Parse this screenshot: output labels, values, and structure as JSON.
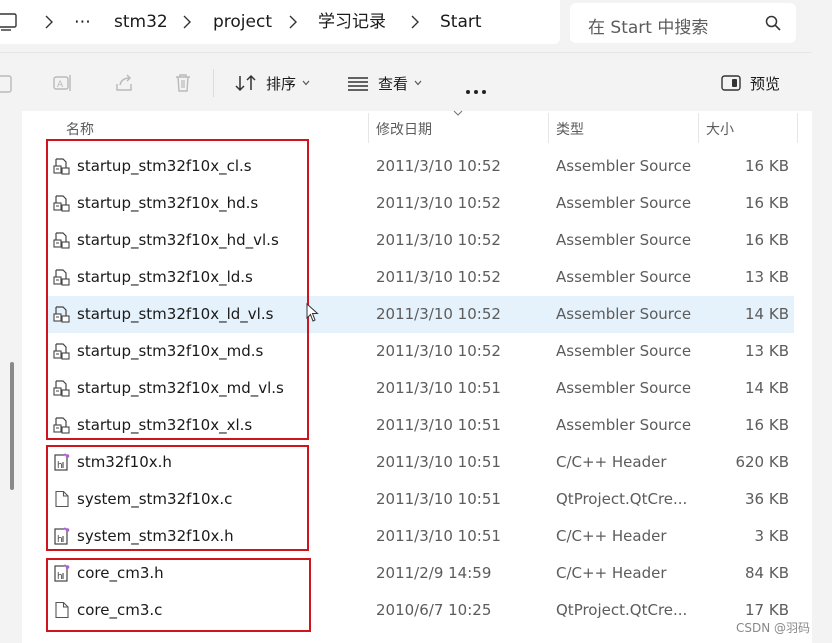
{
  "address": {
    "crumbs": [
      "⋯",
      "stm32",
      "project",
      "学习记录",
      "Start"
    ]
  },
  "search": {
    "placeholder": "在 Start 中搜索"
  },
  "toolbar": {
    "sort_label": "排序",
    "view_label": "查看",
    "preview_label": "预览"
  },
  "columns": {
    "name": "名称",
    "modified": "修改日期",
    "type": "类型",
    "size": "大小"
  },
  "files": [
    {
      "name": "startup_stm32f10x_cl.s",
      "modified": "2011/3/10 10:52",
      "type": "Assembler Source",
      "size": "16 KB",
      "icon": "assembler-file-icon"
    },
    {
      "name": "startup_stm32f10x_hd.s",
      "modified": "2011/3/10 10:52",
      "type": "Assembler Source",
      "size": "16 KB",
      "icon": "assembler-file-icon"
    },
    {
      "name": "startup_stm32f10x_hd_vl.s",
      "modified": "2011/3/10 10:52",
      "type": "Assembler Source",
      "size": "16 KB",
      "icon": "assembler-file-icon"
    },
    {
      "name": "startup_stm32f10x_ld.s",
      "modified": "2011/3/10 10:52",
      "type": "Assembler Source",
      "size": "13 KB",
      "icon": "assembler-file-icon"
    },
    {
      "name": "startup_stm32f10x_ld_vl.s",
      "modified": "2011/3/10 10:52",
      "type": "Assembler Source",
      "size": "14 KB",
      "icon": "assembler-file-icon"
    },
    {
      "name": "startup_stm32f10x_md.s",
      "modified": "2011/3/10 10:52",
      "type": "Assembler Source",
      "size": "13 KB",
      "icon": "assembler-file-icon"
    },
    {
      "name": "startup_stm32f10x_md_vl.s",
      "modified": "2011/3/10 10:51",
      "type": "Assembler Source",
      "size": "14 KB",
      "icon": "assembler-file-icon"
    },
    {
      "name": "startup_stm32f10x_xl.s",
      "modified": "2011/3/10 10:51",
      "type": "Assembler Source",
      "size": "16 KB",
      "icon": "assembler-file-icon"
    },
    {
      "name": "stm32f10x.h",
      "modified": "2011/3/10 10:51",
      "type": "C/C++ Header",
      "size": "620 KB",
      "icon": "header-file-icon"
    },
    {
      "name": "system_stm32f10x.c",
      "modified": "2011/3/10 10:51",
      "type": "QtProject.QtCre...",
      "size": "36 KB",
      "icon": "blank-file-icon"
    },
    {
      "name": "system_stm32f10x.h",
      "modified": "2011/3/10 10:51",
      "type": "C/C++ Header",
      "size": "3 KB",
      "icon": "header-file-icon"
    },
    {
      "name": "core_cm3.h",
      "modified": "2011/2/9 14:59",
      "type": "C/C++ Header",
      "size": "84 KB",
      "icon": "header-file-icon"
    },
    {
      "name": "core_cm3.c",
      "modified": "2010/6/7 10:25",
      "type": "QtProject.QtCre...",
      "size": "17 KB",
      "icon": "blank-file-icon"
    }
  ],
  "selected_index": 4,
  "watermark": "CSDN @羽码",
  "colors": {
    "highlight_box": "#d0141e",
    "selected_row": "#e5f1fb"
  }
}
